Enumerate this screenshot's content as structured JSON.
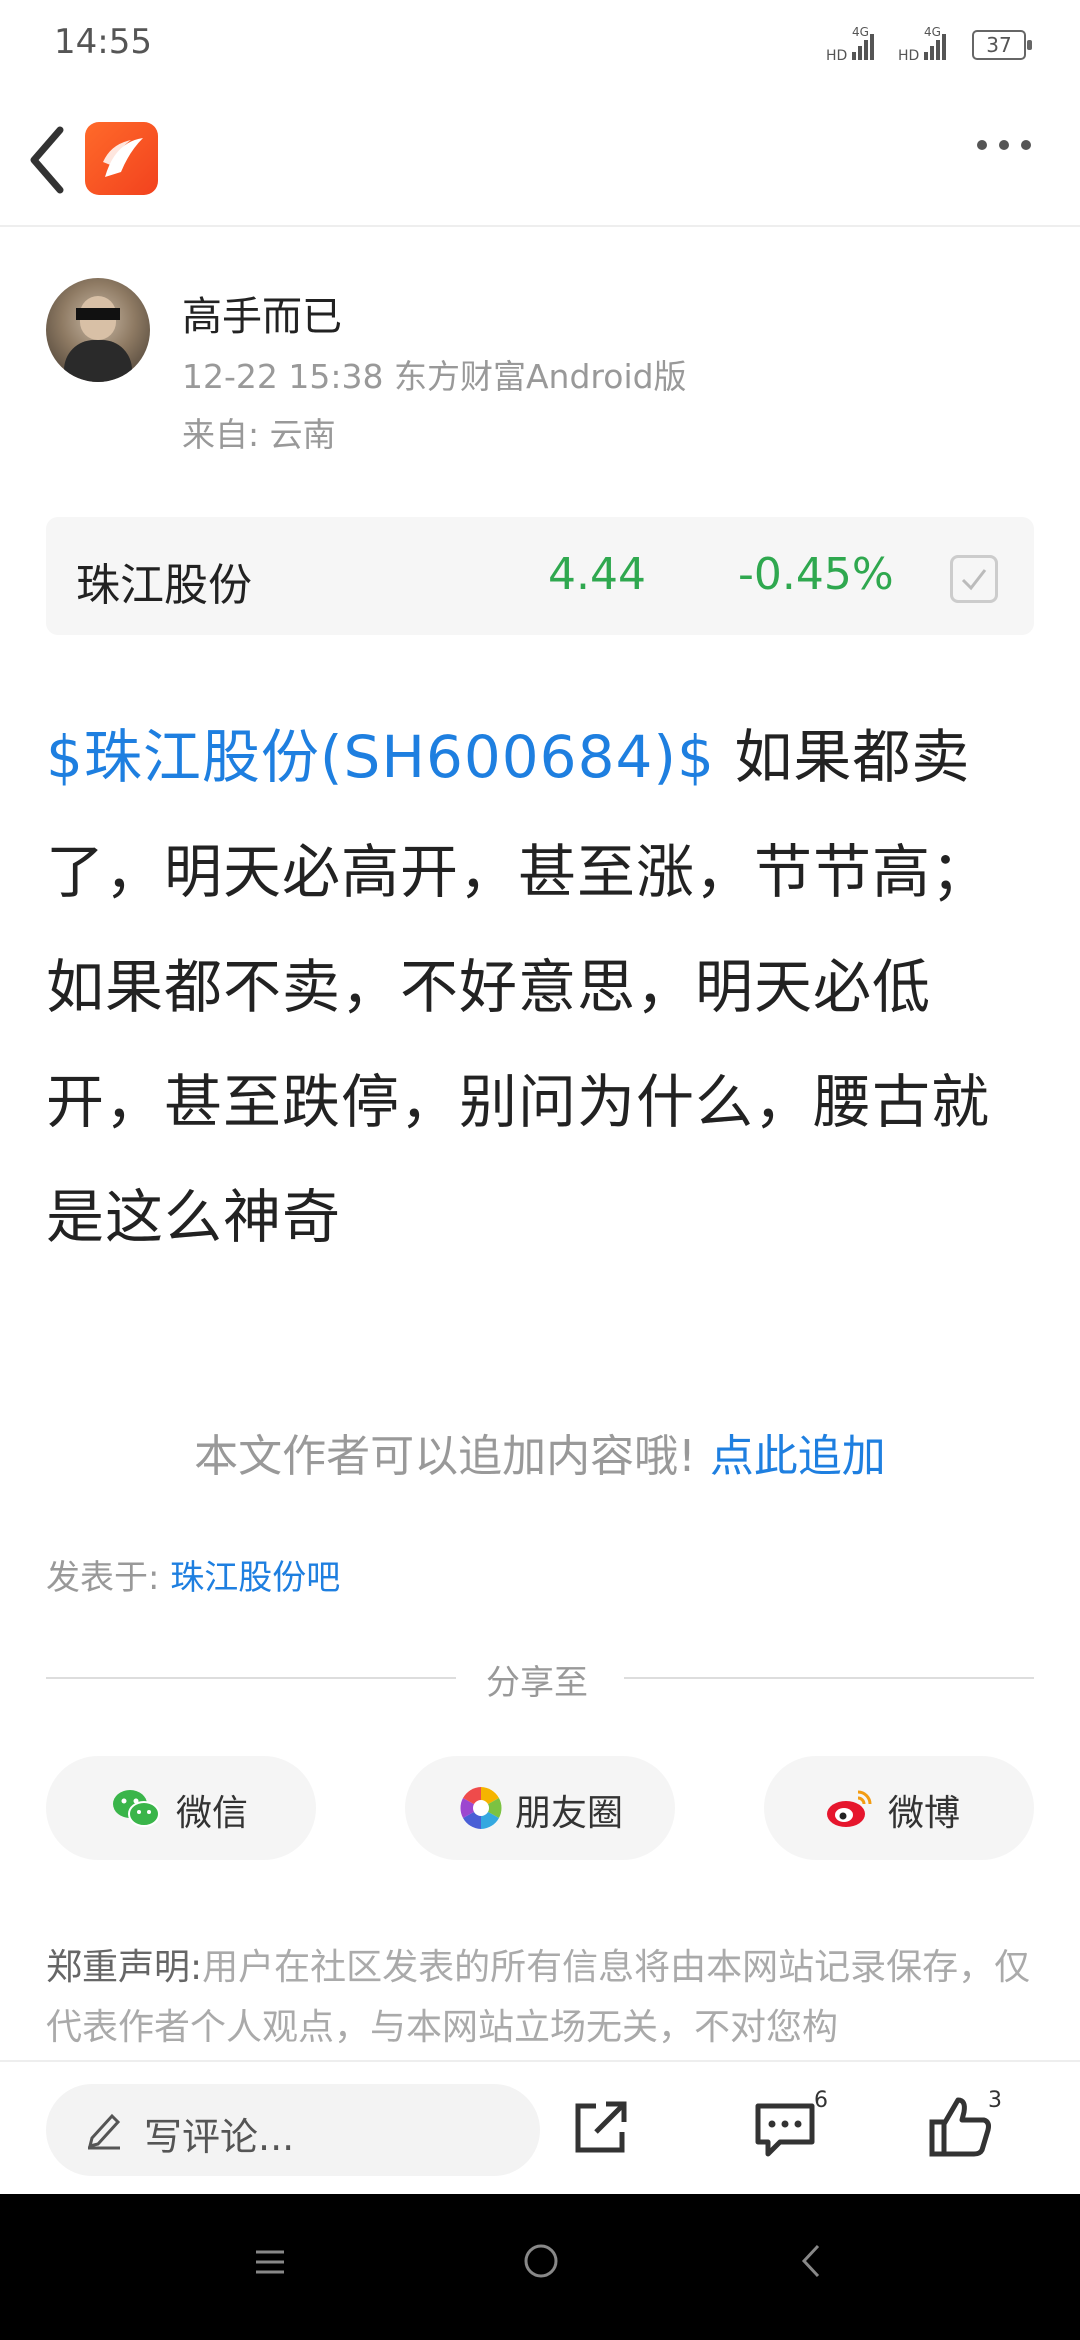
{
  "status_bar": {
    "time": "14:55",
    "signal1": "HD 4G",
    "signal2": "HD 4G",
    "battery": "37"
  },
  "header": {
    "back_icon": "chevron-left-icon",
    "logo": "eastmoney-logo",
    "more_icon": "more-dots-icon",
    "more_label": "···"
  },
  "author": {
    "name": "高手而已",
    "meta": "12-22 15:38 东方财富Android版",
    "from": "来自: 云南"
  },
  "stock": {
    "name": "珠江股份",
    "price": "4.44",
    "change": "-0.45%",
    "color": "#2fa84f"
  },
  "post": {
    "tag": "$珠江股份(SH600684)$",
    "text": " 如果都卖了，明天必高开，甚至涨，节节高；如果都不卖，不好意思，明天必低开，甚至跌停，别问为什么，腰古就是这么神奇"
  },
  "append": {
    "prompt": "本文作者可以追加内容哦!",
    "link": "点此追加"
  },
  "posted_in": {
    "label": "发表于:",
    "link": "珠江股份吧"
  },
  "share": {
    "title": "分享至",
    "buttons": [
      {
        "label": "微信",
        "icon": "wechat-icon"
      },
      {
        "label": "朋友圈",
        "icon": "moments-icon"
      },
      {
        "label": "微博",
        "icon": "weibo-icon"
      }
    ]
  },
  "disclaimer": {
    "bold": "郑重声明:",
    "text": "用户在社区发表的所有信息将由本网站记录保存，仅代表作者个人观点，与本网站立场无关，不对您构"
  },
  "actions": {
    "comment_placeholder": "写评论...",
    "comment_count": "6",
    "like_count": "3"
  },
  "accent": "#1e7fe0"
}
